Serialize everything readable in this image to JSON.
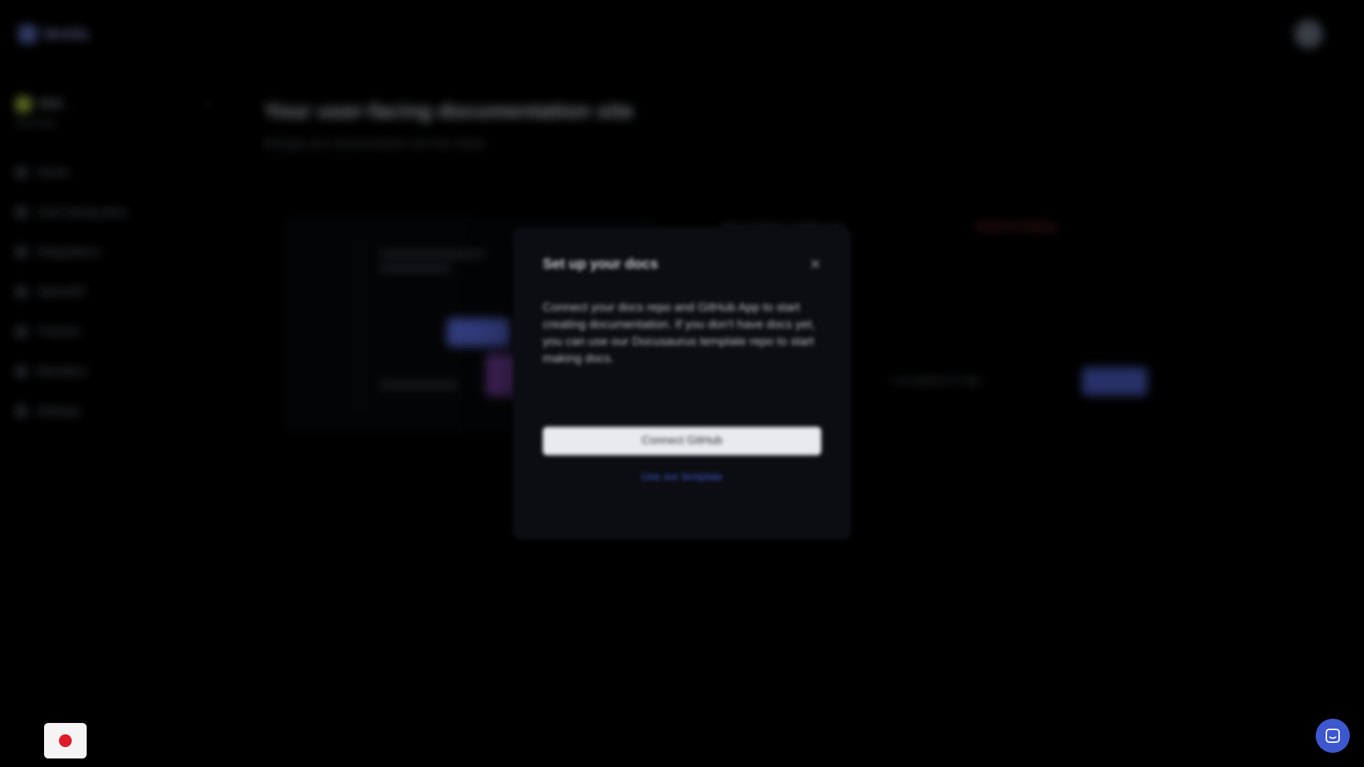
{
  "brand": {
    "name": "Mintlify",
    "logo_icon": "mintlify-logo-icon"
  },
  "org": {
    "name": "Nikki",
    "plan": "Free Plan"
  },
  "sidebar": {
    "items": [
      {
        "label": "Home",
        "icon": "home-icon"
      },
      {
        "label": "User-facing docs",
        "icon": "book-icon"
      },
      {
        "label": "Integrations",
        "icon": "plug-icon"
      },
      {
        "label": "OpenAPI",
        "icon": "code-icon"
      },
      {
        "label": "Themes",
        "icon": "palette-icon"
      },
      {
        "label": "Members",
        "icon": "users-icon"
      },
      {
        "label": "Settings",
        "icon": "gear-icon"
      }
    ]
  },
  "main": {
    "title": "Your user-facing documentation site",
    "subtitle": "Manage your documentation and site status"
  },
  "site": {
    "url": "nikki-a1bde2.mintlify.app",
    "status": "Failed to Deploy",
    "meta": "Last updated 2h ago",
    "editor_label": "Editor"
  },
  "modal": {
    "title": "Set up your docs",
    "body": "Connect your docs repo and GitHub App to start creating documentation. If you don't have docs yet, you can use our Docusaurus template repo to start making docs.",
    "primary_label": "Connect GitHub",
    "secondary_label": "Use our template"
  },
  "colors": {
    "accent": "#3d57cf",
    "recorder": "#e01b2b",
    "background": "#000000",
    "modal_bg": "#0b0d12"
  }
}
